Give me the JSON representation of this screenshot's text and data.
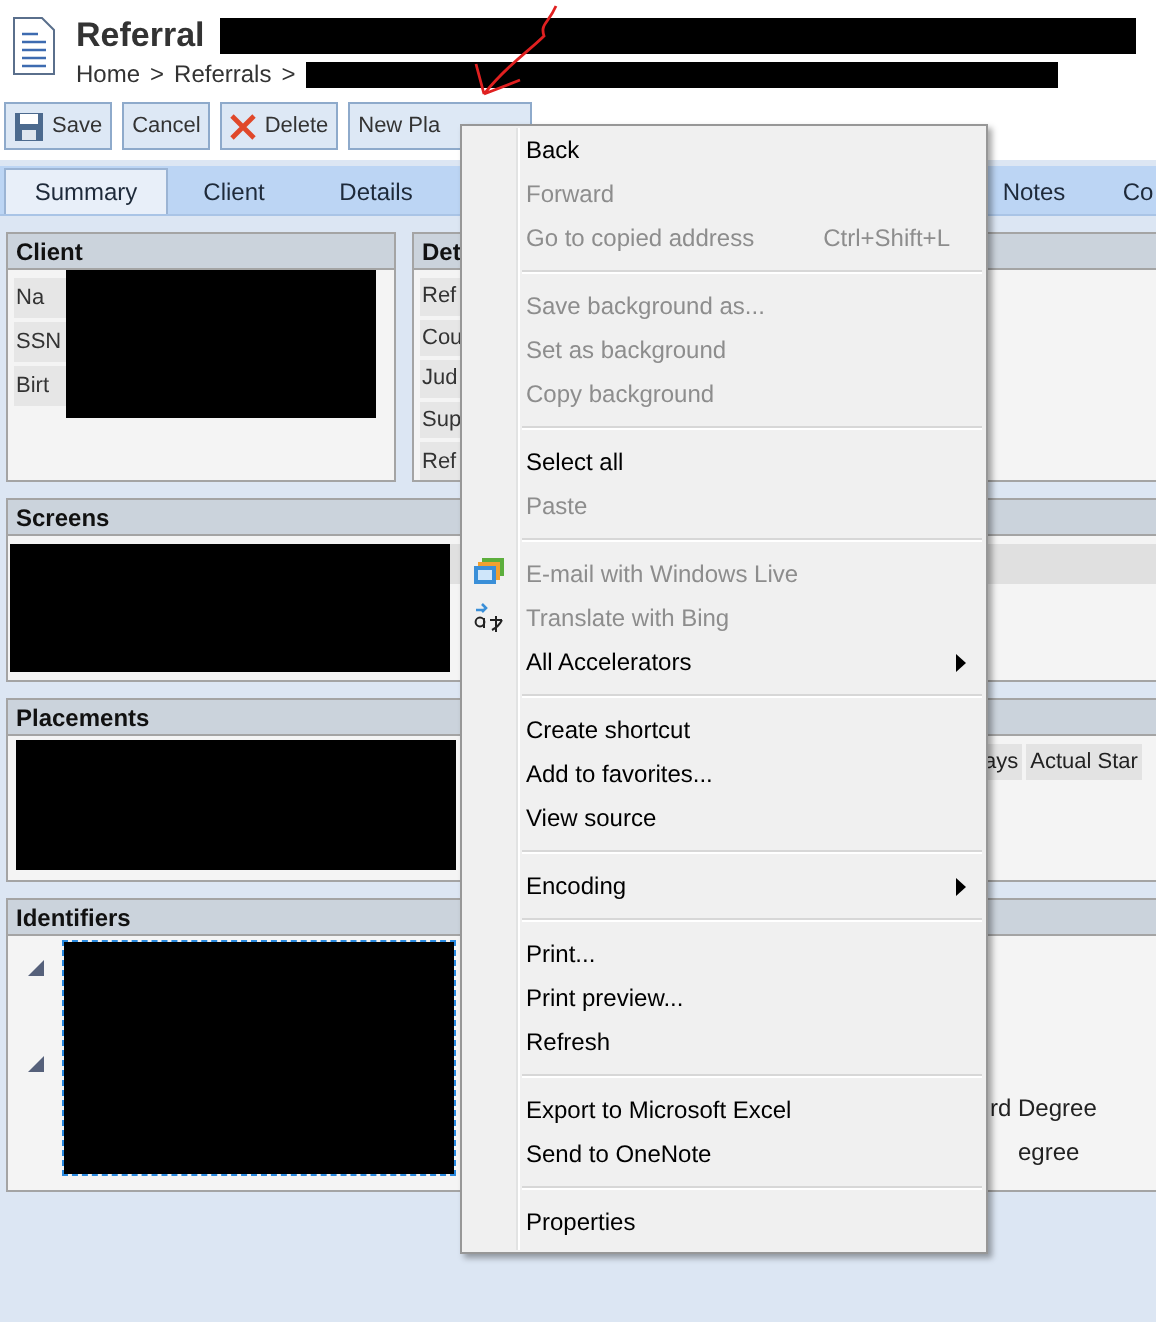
{
  "header": {
    "title": "Referral",
    "breadcrumb": [
      "Home",
      ">",
      "Referrals",
      ">"
    ]
  },
  "toolbar": [
    {
      "label": "Save",
      "kind": "save"
    },
    {
      "label": "Cancel",
      "kind": "plain"
    },
    {
      "label": "Delete",
      "kind": "delete"
    },
    {
      "label": "New Pla",
      "kind": "plain"
    }
  ],
  "tabs": [
    {
      "label": "Summary",
      "selected": true
    },
    {
      "label": "Client",
      "selected": false
    },
    {
      "label": "Details",
      "selected": false
    },
    {
      "label": "Notes",
      "selected": false
    },
    {
      "label": "Co",
      "selected": false
    }
  ],
  "client_panel": {
    "title": "Client",
    "labels": [
      "Na",
      "SSN",
      "Birt"
    ]
  },
  "details_panel": {
    "title": "Det",
    "labels": [
      "Ref",
      "Cou",
      "Jud",
      "Sup",
      "Ref"
    ]
  },
  "screens_panel": {
    "title": "Screens"
  },
  "placements_panel": {
    "title": "Placements",
    "columns": [
      "ays",
      "Actual Star"
    ]
  },
  "identifiers_panel": {
    "title": "Identifiers",
    "values": [
      "rd Degree",
      "egree"
    ]
  },
  "context_menu": [
    [
      {
        "label": "Back",
        "disabled": false,
        "kind": "plain",
        "submenu": false
      },
      {
        "label": "Forward",
        "disabled": true,
        "kind": "plain",
        "submenu": false
      },
      {
        "label": "Go to copied address",
        "shortcut": "Ctrl+Shift+L",
        "disabled": true,
        "kind": "plain",
        "submenu": false
      }
    ],
    [
      {
        "label": "Save background as...",
        "disabled": true,
        "kind": "plain",
        "submenu": false
      },
      {
        "label": "Set as background",
        "disabled": true,
        "kind": "plain",
        "submenu": false
      },
      {
        "label": "Copy background",
        "disabled": true,
        "kind": "plain",
        "submenu": false
      }
    ],
    [
      {
        "label": "Select all",
        "disabled": false,
        "kind": "plain",
        "submenu": false
      },
      {
        "label": "Paste",
        "disabled": true,
        "kind": "plain",
        "submenu": false
      }
    ],
    [
      {
        "label": "E-mail with Windows Live",
        "disabled": true,
        "kind": "email",
        "submenu": false
      },
      {
        "label": "Translate with Bing",
        "disabled": true,
        "kind": "translate",
        "submenu": false
      },
      {
        "label": "All Accelerators",
        "disabled": false,
        "kind": "plain",
        "submenu": true
      }
    ],
    [
      {
        "label": "Create shortcut",
        "disabled": false,
        "kind": "plain",
        "submenu": false
      },
      {
        "label": "Add to favorites...",
        "disabled": false,
        "kind": "plain",
        "submenu": false
      },
      {
        "label": "View source",
        "disabled": false,
        "kind": "plain",
        "submenu": false
      }
    ],
    [
      {
        "label": "Encoding",
        "disabled": false,
        "kind": "plain",
        "submenu": true
      }
    ],
    [
      {
        "label": "Print...",
        "disabled": false,
        "kind": "plain",
        "submenu": false
      },
      {
        "label": "Print preview...",
        "disabled": false,
        "kind": "plain",
        "submenu": false
      },
      {
        "label": "Refresh",
        "disabled": false,
        "kind": "plain",
        "submenu": false
      }
    ],
    [
      {
        "label": "Export to Microsoft Excel",
        "disabled": false,
        "kind": "plain",
        "submenu": false
      },
      {
        "label": "Send to OneNote",
        "disabled": false,
        "kind": "plain",
        "submenu": false
      }
    ],
    [
      {
        "label": "Properties",
        "disabled": false,
        "kind": "plain",
        "submenu": false
      }
    ]
  ]
}
